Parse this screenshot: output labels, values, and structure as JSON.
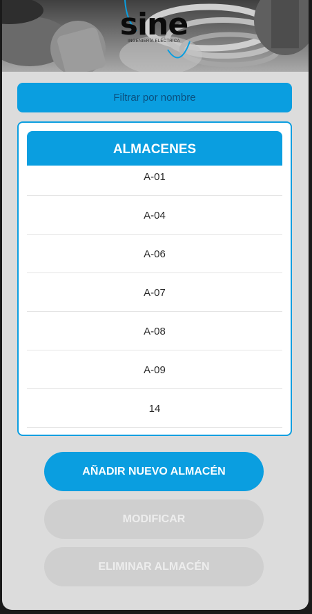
{
  "header": {
    "logo_text": "sine",
    "logo_subtitle": "INGENIERÍA ELÉCTRICA"
  },
  "filter": {
    "placeholder": "Filtrar por nombre"
  },
  "list": {
    "title": "ALMACENES",
    "items": [
      "A-01",
      "A-04",
      "A-06",
      "A-07",
      "A-08",
      "A-09",
      "14"
    ]
  },
  "buttons": {
    "add": "AÑADIR NUEVO ALMACÉN",
    "modify": "MODIFICAR",
    "delete": "ELIMINAR ALMACÉN"
  },
  "colors": {
    "accent": "#0a9ee0",
    "disabled_button": "#cfcfcf",
    "background": "#dcdcdc"
  }
}
